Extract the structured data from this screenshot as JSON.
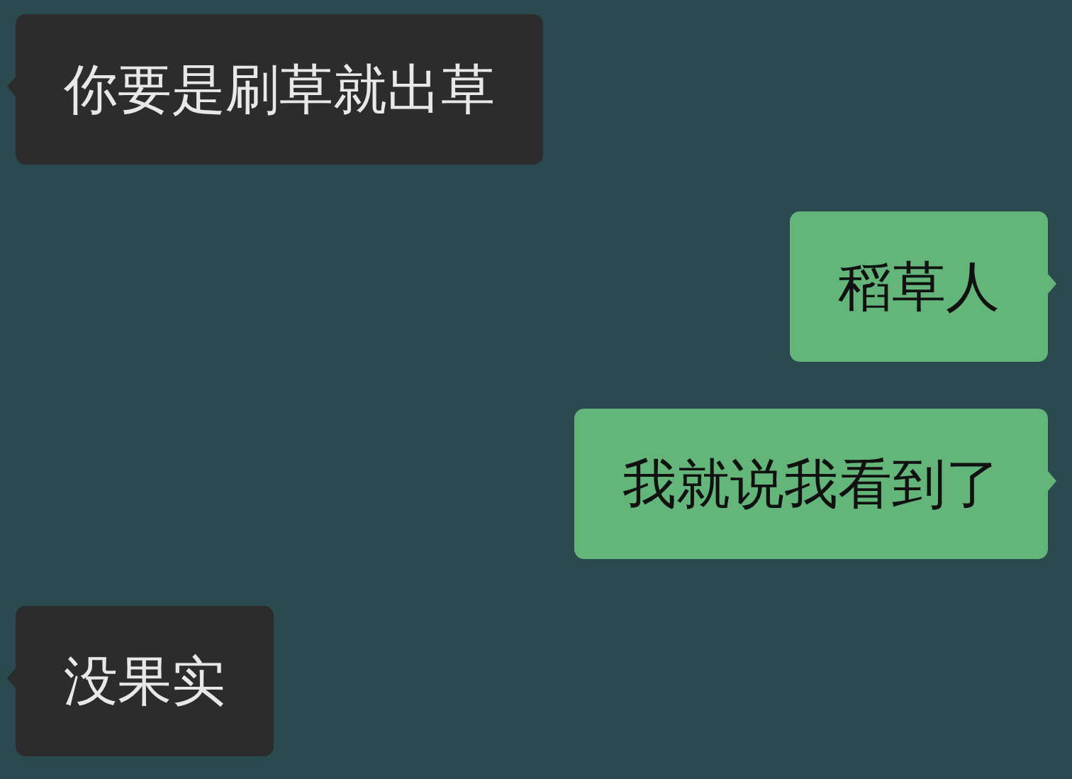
{
  "messages": [
    {
      "text": "你要是刷草就出草",
      "kind": "incoming"
    },
    {
      "text": "稻草人",
      "kind": "outgoing"
    },
    {
      "text": "我就说我看到了",
      "kind": "outgoing"
    },
    {
      "text": "没果实",
      "kind": "incoming"
    }
  ]
}
